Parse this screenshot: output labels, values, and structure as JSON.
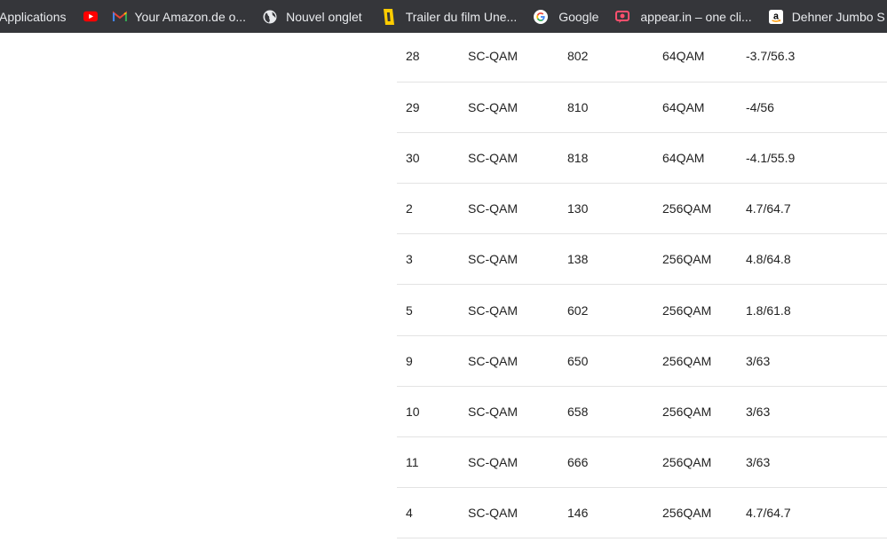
{
  "bookmarks_bar": {
    "items": [
      {
        "label": "Applications",
        "icon": ""
      },
      {
        "label": "",
        "icon": "youtube-icon"
      },
      {
        "label": "Your Amazon.de o...",
        "icon": "gmail-icon"
      },
      {
        "label": "Nouvel onglet",
        "icon": "globe-icon"
      },
      {
        "label": "Trailer du film Une...",
        "icon": "film-ticket-icon"
      },
      {
        "label": "Google",
        "icon": "google-icon"
      },
      {
        "label": "appear.in – one cli...",
        "icon": "appear-in-icon"
      },
      {
        "label": "Dehner Jumbo S",
        "icon": "amazon-icon"
      }
    ]
  },
  "channel_table": {
    "rows": [
      {
        "id": "28",
        "type": "SC-QAM",
        "frequency": "802",
        "modulation": "64QAM",
        "power_snr": "-3.7/56.3"
      },
      {
        "id": "29",
        "type": "SC-QAM",
        "frequency": "810",
        "modulation": "64QAM",
        "power_snr": "-4/56"
      },
      {
        "id": "30",
        "type": "SC-QAM",
        "frequency": "818",
        "modulation": "64QAM",
        "power_snr": "-4.1/55.9"
      },
      {
        "id": "2",
        "type": "SC-QAM",
        "frequency": "130",
        "modulation": "256QAM",
        "power_snr": "4.7/64.7"
      },
      {
        "id": "3",
        "type": "SC-QAM",
        "frequency": "138",
        "modulation": "256QAM",
        "power_snr": "4.8/64.8"
      },
      {
        "id": "5",
        "type": "SC-QAM",
        "frequency": "602",
        "modulation": "256QAM",
        "power_snr": "1.8/61.8"
      },
      {
        "id": "9",
        "type": "SC-QAM",
        "frequency": "650",
        "modulation": "256QAM",
        "power_snr": "3/63"
      },
      {
        "id": "10",
        "type": "SC-QAM",
        "frequency": "658",
        "modulation": "256QAM",
        "power_snr": "3/63"
      },
      {
        "id": "11",
        "type": "SC-QAM",
        "frequency": "666",
        "modulation": "256QAM",
        "power_snr": "3/63"
      },
      {
        "id": "4",
        "type": "SC-QAM",
        "frequency": "146",
        "modulation": "256QAM",
        "power_snr": "4.7/64.7"
      }
    ]
  },
  "colors": {
    "bookmarks_bar_bg": "#35363a",
    "bookmarks_text": "#e8eaed",
    "table_text": "#222222",
    "row_divider": "#e3e3e3",
    "youtube_red": "#ff0000",
    "amazon_orange": "#ff9900"
  }
}
